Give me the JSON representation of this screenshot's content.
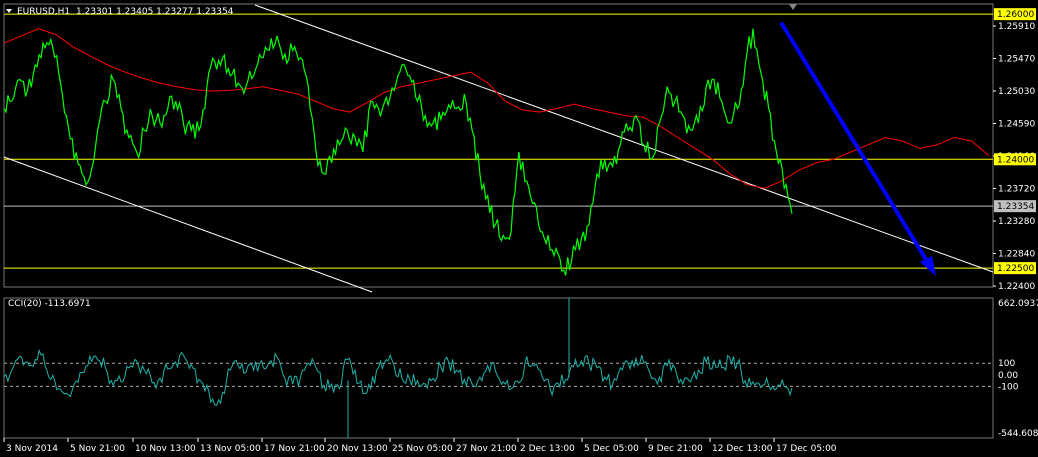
{
  "header": {
    "symbol_label": "EURUSD,H1",
    "ohlc": "1.23301 1.23405 1.23277 1.23354"
  },
  "cci_header": "CCI(20) -113.6971",
  "colors": {
    "background": "#000000",
    "price": "#00FF00",
    "moving_average": "#FF0000",
    "channel": "#FFFFFF",
    "level_line": "#FFFF00",
    "current_price_line": "#C0C0C0",
    "arrow": "#0000FF",
    "cci": "#20B2AA"
  },
  "price_axis_labels": [
    "1.25910",
    "1.25470",
    "1.25030",
    "1.24590",
    "1.24160",
    "1.23720",
    "1.23280",
    "1.22840",
    "1.22400"
  ],
  "level_tags": [
    "1.26000",
    "1.24000",
    "1.23354",
    "1.22500"
  ],
  "cci_axis_labels": [
    "662.0937",
    "100",
    "0.00",
    "-100",
    "-544.6083"
  ],
  "time_labels": [
    "3 Nov 2014",
    "5 Nov 21:00",
    "10 Nov 13:00",
    "13 Nov 05:00",
    "17 Nov 21:00",
    "20 Nov 13:00",
    "25 Nov 05:00",
    "27 Nov 21:00",
    "2 Dec 13:00",
    "5 Dec 05:00",
    "9 Dec 21:00",
    "12 Dec 13:00",
    "17 Dec 05:00"
  ],
  "chart_data": [
    {
      "type": "line",
      "title": "EURUSD,H1",
      "ylim": [
        1.2224,
        1.2614
      ],
      "horizontal_levels": [
        1.26,
        1.24,
        1.23354,
        1.225
      ],
      "series": [
        {
          "values": [
            1.247,
            1.248,
            1.251,
            1.2495,
            1.253,
            1.256,
            1.2565,
            1.252,
            1.246,
            1.24,
            1.238,
            1.2375,
            1.244,
            1.248,
            1.251,
            1.247,
            1.243,
            1.241,
            1.244,
            1.246,
            1.245,
            1.247,
            1.248,
            1.245,
            1.244,
            1.244,
            1.25,
            1.2535,
            1.254,
            1.2515,
            1.2505,
            1.25,
            1.2515,
            1.254,
            1.255,
            1.257,
            1.2545,
            1.255,
            1.254,
            1.25,
            1.241,
            1.238,
            1.2395,
            1.242,
            1.244,
            1.243,
            1.241,
            1.248,
            1.247,
            1.2485,
            1.2495,
            1.253,
            1.2515,
            1.248,
            1.246,
            1.245,
            1.2455,
            1.2475,
            1.247,
            1.249,
            1.244,
            1.238,
            1.235,
            1.231,
            1.2295,
            1.23,
            1.241,
            1.237,
            1.234,
            1.23,
            1.2275,
            1.227,
            1.224,
            1.228,
            1.229,
            1.231,
            1.238,
            1.24,
            1.239,
            1.242,
            1.244,
            1.246,
            1.242,
            1.24,
            1.245,
            1.25,
            1.248,
            1.246,
            1.244,
            1.245,
            1.25,
            1.251,
            1.248,
            1.245,
            1.247,
            1.253,
            1.258,
            1.252,
            1.247,
            1.241,
            1.236,
            1.2325
          ],
          "color": "#00FF00"
        },
        {
          "values": [
            1.256,
            1.257,
            1.258,
            1.2572,
            1.2555,
            1.2542,
            1.253,
            1.252,
            1.2512,
            1.2505,
            1.25,
            1.2496,
            1.2494,
            1.2495,
            1.2497,
            1.25,
            1.2495,
            1.249,
            1.248,
            1.247,
            1.2465,
            1.2478,
            1.2492,
            1.25,
            1.2505,
            1.251,
            1.2515,
            1.252,
            1.2505,
            1.248,
            1.2468,
            1.2465,
            1.247,
            1.2476,
            1.247,
            1.2465,
            1.246,
            1.2458,
            1.2445,
            1.243,
            1.2415,
            1.24,
            1.238,
            1.2365,
            1.236,
            1.237,
            1.2385,
            1.2395,
            1.24,
            1.241,
            1.242,
            1.243,
            1.2425,
            1.2415,
            1.242,
            1.243,
            1.2425,
            1.2405
          ],
          "color": "#FF0000"
        }
      ]
    },
    {
      "type": "line",
      "title": "CCI(20) -113.6971",
      "ylim": [
        -544.6083,
        662.0937
      ],
      "horizontal_levels": [
        100,
        0,
        -100
      ],
      "series": [
        {
          "values": [
            -20,
            40,
            160,
            110,
            130,
            180,
            -40,
            -120,
            -160,
            -80,
            20,
            160,
            130,
            60,
            -90,
            -60,
            60,
            120,
            40,
            -70,
            -30,
            50,
            110,
            170,
            90,
            -40,
            -90,
            -260,
            -150,
            40,
            80,
            20,
            40,
            120,
            110,
            150,
            -30,
            -80,
            -20,
            100,
            60,
            -90,
            -80,
            -120,
            130,
            40,
            -160,
            -120,
            60,
            130,
            80,
            -30,
            -40,
            -50,
            -80,
            -30,
            70,
            110,
            40,
            -40,
            -80,
            -20,
            80,
            30,
            -60,
            -120,
            -70,
            160,
            80,
            -20,
            -120,
            -70,
            -40,
            70,
            120,
            90,
            60,
            -20,
            -80,
            60,
            100,
            140,
            100,
            -30,
            -20,
            80,
            60,
            -80,
            -60,
            40,
            110,
            120,
            60,
            150,
            100,
            -50,
            -60,
            -110,
            -90,
            -120,
            -100,
            -114
          ],
          "color": "#20B2AA"
        }
      ]
    }
  ]
}
